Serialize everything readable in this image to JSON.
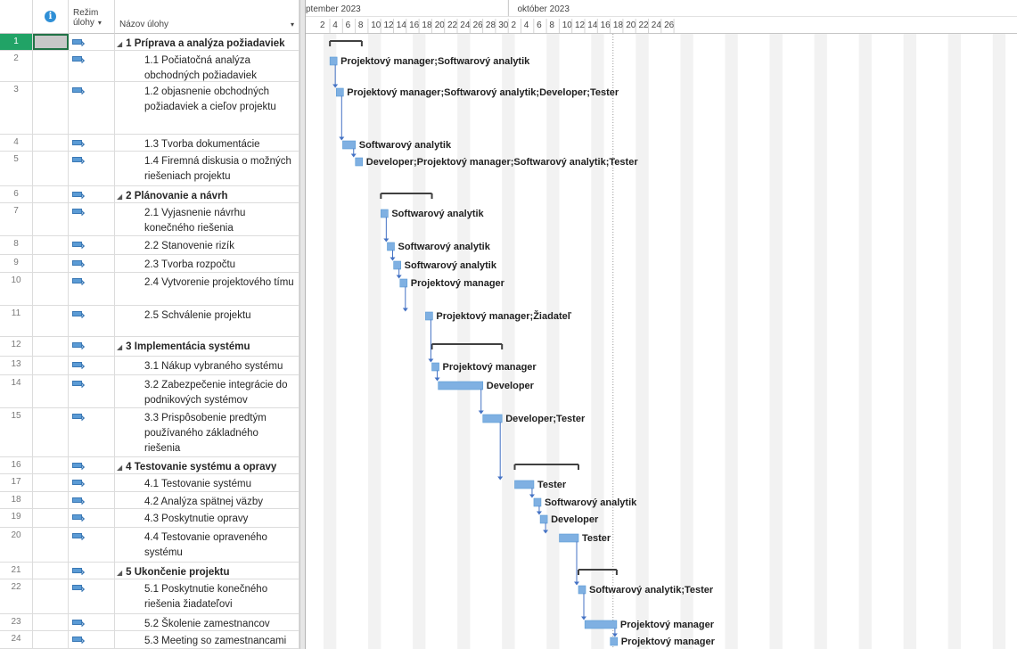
{
  "header": {
    "info_icon": "info-icon",
    "mode_label_line1": "Režim",
    "mode_label_line2": "úlohy",
    "name_label": "Názov úlohy",
    "sort_glyph": "▾"
  },
  "timescale": {
    "month_left": "ptember 2023",
    "month_right": "október 2023",
    "days": [
      "2",
      "4",
      "6",
      "8",
      "10",
      "12",
      "14",
      "16",
      "18",
      "20",
      "22",
      "24",
      "26",
      "28",
      "30",
      "2",
      "4",
      "6",
      "8",
      "10",
      "12",
      "14",
      "16",
      "18",
      "20",
      "22",
      "24",
      "26"
    ]
  },
  "colors": {
    "bar": "#7fb0e2",
    "bar_border": "#5b9bd5",
    "summary": "#404040",
    "link": "#4472c4",
    "weekend": "#f2f2f2",
    "selected_row": "#21a366"
  },
  "tasks": [
    {
      "id": "1",
      "name": "1 Príprava a analýza požiadaviek",
      "summary": true,
      "resources": "",
      "start": "2023-09-03",
      "finish": "2023-09-07"
    },
    {
      "id": "2",
      "name": "1.1 Počiatočná analýza obchodných požiadaviek",
      "summary": false,
      "resources": "Projektový manager;Softwarový analytik",
      "start": "2023-09-03",
      "finish": "2023-09-03"
    },
    {
      "id": "3",
      "name": "1.2 objasnenie obchodných požiadaviek a cieľov projektu",
      "summary": false,
      "resources": "Projektový manager;Softwarový analytik;Developer;Tester",
      "start": "2023-09-04",
      "finish": "2023-09-04"
    },
    {
      "id": "4",
      "name": "1.3 Tvorba dokumentácie",
      "summary": false,
      "resources": "Softwarový analytik",
      "start": "2023-09-05",
      "finish": "2023-09-06"
    },
    {
      "id": "5",
      "name": "1.4 Firemná diskusia o možných riešeniach projektu",
      "summary": false,
      "resources": "Developer;Projektový manager;Softwarový analytik;Tester",
      "start": "2023-09-07",
      "finish": "2023-09-07"
    },
    {
      "id": "6",
      "name": "2 Plánovanie a návrh",
      "summary": true,
      "resources": "",
      "start": "2023-09-11",
      "finish": "2023-09-18"
    },
    {
      "id": "7",
      "name": "2.1 Vyjasnenie návrhu konečného riešenia",
      "summary": false,
      "resources": "Softwarový analytik",
      "start": "2023-09-11",
      "finish": "2023-09-11"
    },
    {
      "id": "8",
      "name": "2.2 Stanovenie rizík",
      "summary": false,
      "resources": "Softwarový analytik",
      "start": "2023-09-12",
      "finish": "2023-09-12"
    },
    {
      "id": "9",
      "name": "2.3 Tvorba rozpočtu",
      "summary": false,
      "resources": "Softwarový analytik",
      "start": "2023-09-13",
      "finish": "2023-09-13"
    },
    {
      "id": "10",
      "name": "2.4 Vytvorenie projektového tímu",
      "summary": false,
      "resources": "Projektový manager",
      "start": "2023-09-14",
      "finish": "2023-09-14"
    },
    {
      "id": "11",
      "name": "2.5 Schválenie projektu",
      "summary": false,
      "resources": "Projektový manager;Žiadateľ",
      "start": "2023-09-18",
      "finish": "2023-09-18"
    },
    {
      "id": "12",
      "name": "3 Implementácia systému",
      "summary": true,
      "resources": "",
      "start": "2023-09-19",
      "finish": "2023-09-29"
    },
    {
      "id": "13",
      "name": "3.1 Nákup vybraného systému",
      "summary": false,
      "resources": "Projektový manager",
      "start": "2023-09-19",
      "finish": "2023-09-19"
    },
    {
      "id": "14",
      "name": "3.2 Zabezpečenie integrácie do podnikových systémov",
      "summary": false,
      "resources": "Developer",
      "start": "2023-09-20",
      "finish": "2023-09-26"
    },
    {
      "id": "15",
      "name": "3.3 Prispôsobenie predtým používaného základného riešenia",
      "summary": false,
      "resources": "Developer;Tester",
      "start": "2023-09-27",
      "finish": "2023-09-29"
    },
    {
      "id": "16",
      "name": "4 Testovanie systému a opravy",
      "summary": true,
      "resources": "",
      "start": "2023-10-02",
      "finish": "2023-10-11"
    },
    {
      "id": "17",
      "name": "4.1 Testovanie systému",
      "summary": false,
      "resources": "Tester",
      "start": "2023-10-02",
      "finish": "2023-10-04"
    },
    {
      "id": "18",
      "name": "4.2 Analýza spätnej väzby",
      "summary": false,
      "resources": "Softwarový analytik",
      "start": "2023-10-05",
      "finish": "2023-10-05"
    },
    {
      "id": "19",
      "name": "4.3 Poskytnutie opravy",
      "summary": false,
      "resources": "Developer",
      "start": "2023-10-06",
      "finish": "2023-10-06"
    },
    {
      "id": "20",
      "name": "4.4 Testovanie opraveného systému",
      "summary": false,
      "resources": "Tester",
      "start": "2023-10-09",
      "finish": "2023-10-11"
    },
    {
      "id": "21",
      "name": "5 Ukončenie projektu",
      "summary": true,
      "resources": "",
      "start": "2023-10-12",
      "finish": "2023-10-17"
    },
    {
      "id": "22",
      "name": "5.1 Poskytnutie konečného riešenia žiadateľovi",
      "summary": false,
      "resources": "Softwarový analytik;Tester",
      "start": "2023-10-12",
      "finish": "2023-10-12"
    },
    {
      "id": "23",
      "name": "5.2 Školenie zamestnancov",
      "summary": false,
      "resources": "Projektový manager",
      "start": "2023-10-13",
      "finish": "2023-10-17"
    },
    {
      "id": "24",
      "name": "5.3 Meeting so zamestnancami",
      "summary": false,
      "resources": "Projektový manager",
      "start": "2023-10-17",
      "finish": "2023-10-17"
    }
  ]
}
